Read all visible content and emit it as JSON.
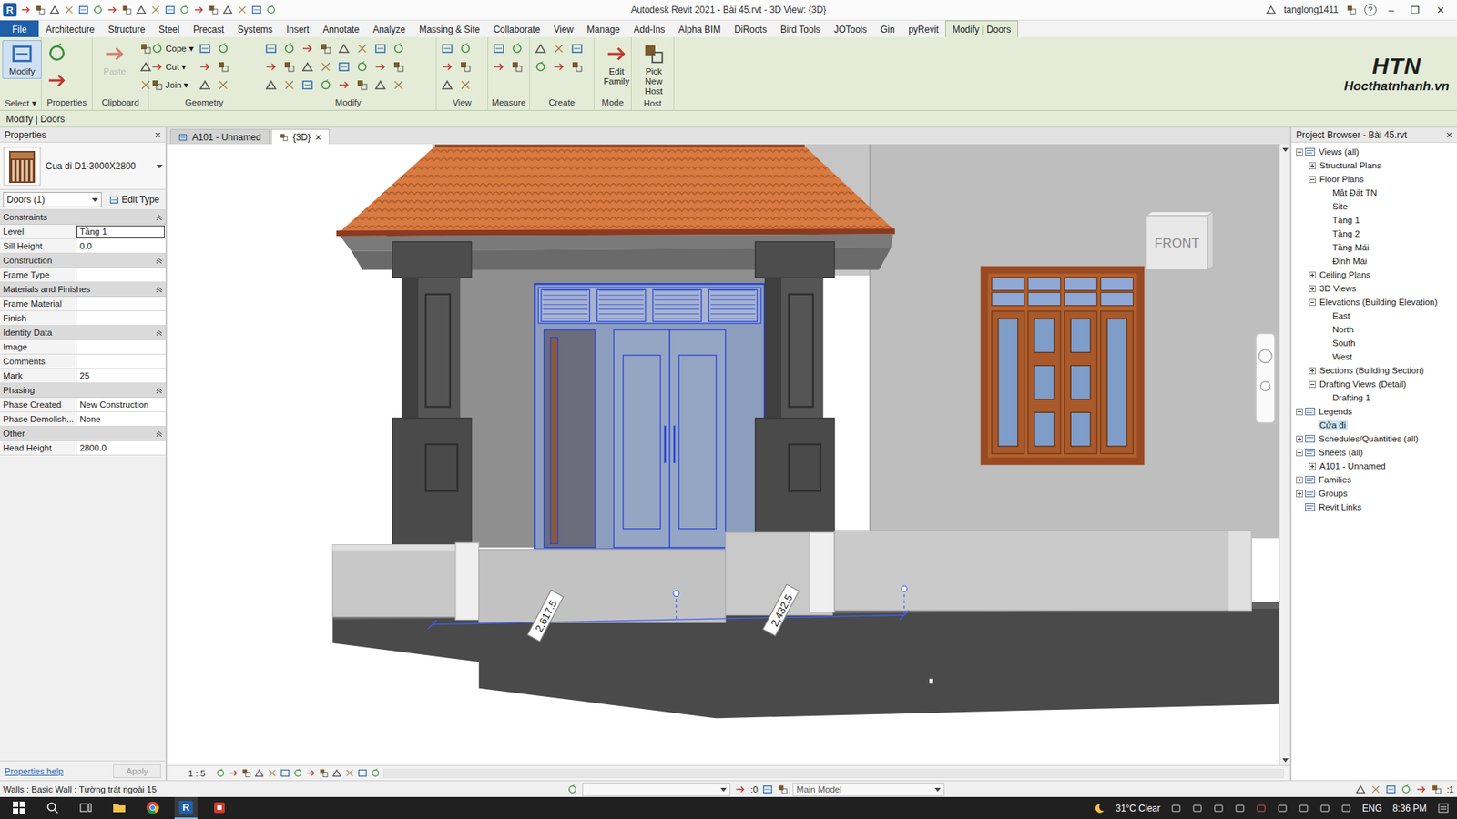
{
  "window": {
    "title": "Autodesk Revit 2021 - Bài 45.rvt - 3D View: {3D}",
    "app_badge": "R",
    "user": "tanglong1411",
    "help": "?",
    "controls": [
      "–",
      "❐",
      "✕"
    ]
  },
  "ribbon_tabs": [
    {
      "label": "File",
      "selected": false
    },
    {
      "label": "Architecture",
      "selected": false
    },
    {
      "label": "Structure",
      "selected": false
    },
    {
      "label": "Steel",
      "selected": false
    },
    {
      "label": "Precast",
      "selected": false
    },
    {
      "label": "Systems",
      "selected": false
    },
    {
      "label": "Insert",
      "selected": false
    },
    {
      "label": "Annotate",
      "selected": false
    },
    {
      "label": "Analyze",
      "selected": false
    },
    {
      "label": "Massing & Site",
      "selected": false
    },
    {
      "label": "Collaborate",
      "selected": false
    },
    {
      "label": "View",
      "selected": false
    },
    {
      "label": "Manage",
      "selected": false
    },
    {
      "label": "Add-Ins",
      "selected": false
    },
    {
      "label": "Alpha BIM",
      "selected": false
    },
    {
      "label": "DiRoots",
      "selected": false
    },
    {
      "label": "Bird Tools",
      "selected": false
    },
    {
      "label": "JOTools",
      "selected": false
    },
    {
      "label": "Gin",
      "selected": false
    },
    {
      "label": "pyRevit",
      "selected": false
    },
    {
      "label": "Modify | Doors",
      "selected": true
    }
  ],
  "ribbon_panels": [
    {
      "label": "Select ▾",
      "large": [
        {
          "label": "Modify",
          "selected": true,
          "disabled": false
        }
      ],
      "small": []
    },
    {
      "label": "Properties",
      "large": [],
      "small": []
    },
    {
      "label": "Clipboard",
      "large": [
        {
          "label": "Paste",
          "selected": false,
          "disabled": true
        }
      ],
      "small": []
    },
    {
      "label": "Geometry",
      "large": [],
      "small": [
        {
          "label": "Cope ▾"
        },
        {
          "label": "Cut ▾"
        },
        {
          "label": "Join ▾"
        }
      ]
    },
    {
      "label": "Modify",
      "large": [],
      "small": []
    },
    {
      "label": "View",
      "large": [],
      "small": []
    },
    {
      "label": "Measure",
      "large": [],
      "small": []
    },
    {
      "label": "Create",
      "large": [],
      "small": []
    },
    {
      "label": "Mode",
      "large": [
        {
          "label": "Edit Family",
          "selected": false,
          "disabled": false
        }
      ],
      "small": []
    },
    {
      "label": "Host",
      "large": [
        {
          "label": "Pick New Host",
          "selected": false,
          "disabled": false
        }
      ],
      "small": []
    }
  ],
  "logo": {
    "mark": "HTN",
    "site": "Hocthatnhanh.vn"
  },
  "context_bar": "Modify | Doors",
  "properties": {
    "title": "Properties",
    "close": "×",
    "type_name": "Cua di D1-3000X2800",
    "selector": "Doors (1)",
    "edit_type": "Edit Type",
    "groups": [
      {
        "name": "Constraints",
        "expanded": true,
        "rows": [
          {
            "label": "Level",
            "value": "Tầng 1",
            "focused": true
          },
          {
            "label": "Sill Height",
            "value": "0.0",
            "focused": false
          }
        ]
      },
      {
        "name": "Construction",
        "expanded": true,
        "rows": [
          {
            "label": "Frame Type",
            "value": "",
            "focused": false
          }
        ]
      },
      {
        "name": "Materials and Finishes",
        "expanded": true,
        "rows": [
          {
            "label": "Frame Material",
            "value": "",
            "focused": false
          },
          {
            "label": "Finish",
            "value": "",
            "focused": false
          }
        ]
      },
      {
        "name": "Identity Data",
        "expanded": true,
        "rows": [
          {
            "label": "Image",
            "value": "",
            "focused": false
          },
          {
            "label": "Comments",
            "value": "",
            "focused": false
          },
          {
            "label": "Mark",
            "value": "25",
            "focused": false
          }
        ]
      },
      {
        "name": "Phasing",
        "expanded": true,
        "rows": [
          {
            "label": "Phase Created",
            "value": "New Construction",
            "focused": false
          },
          {
            "label": "Phase Demolish...",
            "value": "None",
            "focused": false
          }
        ]
      },
      {
        "name": "Other",
        "expanded": true,
        "rows": [
          {
            "label": "Head Height",
            "value": "2800.0",
            "focused": false
          }
        ]
      }
    ],
    "help": "Properties help",
    "apply": "Apply",
    "apply_disabled": true
  },
  "view": {
    "tabs": [
      {
        "label": "A101 - Unnamed",
        "selected": false,
        "closable": false
      },
      {
        "label": "{3D}",
        "selected": true,
        "closable": true
      }
    ],
    "close": "×",
    "scale": "1 : 5",
    "dimensions": [
      "2,617.5",
      "2,432.5"
    ],
    "viewcube": "FRONT"
  },
  "project_browser": {
    "title": "Project Browser - Bài 45.rvt",
    "close": "×",
    "tree": [
      {
        "label": "Views (all)",
        "expanded": true,
        "selected": false,
        "children": [
          {
            "label": "Structural Plans",
            "expanded": false,
            "selected": false,
            "children": []
          },
          {
            "label": "Floor Plans",
            "expanded": true,
            "selected": false,
            "children": [
              {
                "label": "Mặt Đất TN",
                "selected": false
              },
              {
                "label": "Site",
                "selected": false
              },
              {
                "label": "Tầng 1",
                "selected": false
              },
              {
                "label": "Tầng 2",
                "selected": false
              },
              {
                "label": "Tầng Mái",
                "selected": false
              },
              {
                "label": "Đỉnh Mái",
                "selected": false
              }
            ]
          },
          {
            "label": "Ceiling Plans",
            "expanded": false,
            "selected": false,
            "children": []
          },
          {
            "label": "3D Views",
            "expanded": false,
            "selected": false,
            "children": []
          },
          {
            "label": "Elevations (Building Elevation)",
            "expanded": true,
            "selected": false,
            "children": [
              {
                "label": "East",
                "selected": false
              },
              {
                "label": "North",
                "selected": false
              },
              {
                "label": "South",
                "selected": false
              },
              {
                "label": "West",
                "selected": false
              }
            ]
          },
          {
            "label": "Sections (Building Section)",
            "expanded": false,
            "selected": false,
            "children": []
          },
          {
            "label": "Drafting Views (Detail)",
            "expanded": true,
            "selected": false,
            "children": [
              {
                "label": "Drafting 1",
                "selected": false
              }
            ]
          }
        ]
      },
      {
        "label": "Legends",
        "expanded": true,
        "selected": false,
        "children": [
          {
            "label": "Cửa đi",
            "selected": true
          }
        ]
      },
      {
        "label": "Schedules/Quantities (all)",
        "expanded": false,
        "selected": false,
        "children": []
      },
      {
        "label": "Sheets (all)",
        "expanded": true,
        "selected": false,
        "children": [
          {
            "label": "A101 - Unnamed",
            "expanded": false,
            "selected": false,
            "children": []
          }
        ]
      },
      {
        "label": "Families",
        "expanded": false,
        "selected": false,
        "children": []
      },
      {
        "label": "Groups",
        "expanded": false,
        "selected": false,
        "children": []
      },
      {
        "label": "Revit Links",
        "selected": false
      }
    ]
  },
  "status_bar": {
    "message": "Walls : Basic Wall : Tường trát ngoài 15",
    "selection_count": ":0",
    "model": "Main Model",
    "filter_count": ":1"
  },
  "taskbar": {
    "app_badge": "R",
    "weather": "31°C Clear",
    "language": "ENG",
    "time": "8:36 PM"
  }
}
